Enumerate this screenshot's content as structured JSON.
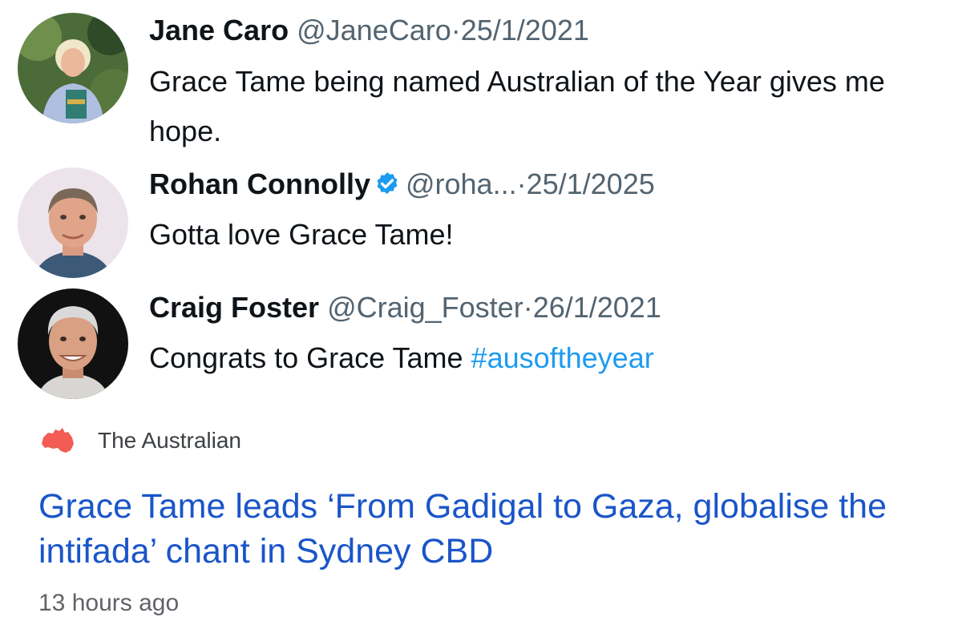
{
  "tweets": [
    {
      "name": "Jane Caro",
      "handle": "@JaneCaro",
      "separator": "·",
      "date": "25/1/2021",
      "text": "Grace Tame being named Australian of the Year gives me hope.",
      "verified": false
    },
    {
      "name": "Rohan Connolly",
      "handle": "@roha...",
      "separator": "·",
      "date": "25/1/2025",
      "text": "Gotta love Grace Tame!",
      "verified": true
    },
    {
      "name": "Craig Foster",
      "handle": "@Craig_Foster",
      "separator": "·",
      "date": "26/1/2021",
      "text": "Congrats to Grace Tame",
      "hashtag": "#ausoftheyear",
      "verified": false
    }
  ],
  "news": {
    "source": "The Australian",
    "source_icon": "australia-map-icon",
    "headline": "Grace Tame leads ‘From Gadigal to Gaza, globalise the intifada’ chant in Sydney CBD",
    "time": "13 hours ago"
  },
  "colors": {
    "verified": "#1d9bf0",
    "hashtag": "#1d9bf0",
    "headline": "#1a55c9",
    "source_icon": "#f25c54"
  }
}
